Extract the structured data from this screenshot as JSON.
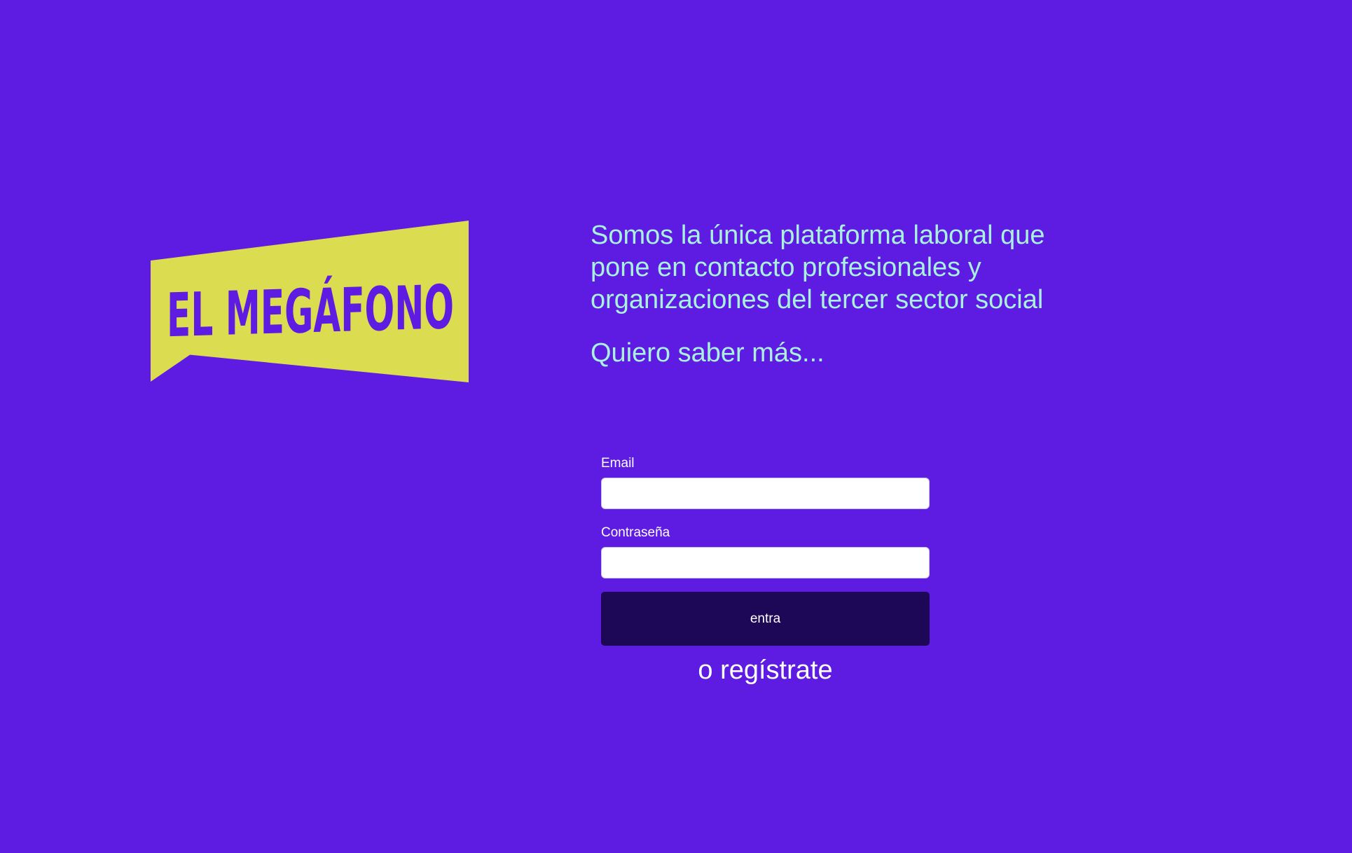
{
  "brand": {
    "logo_text": "EL MEGÁFONO",
    "colors": {
      "background": "#5e1be2",
      "logo_yellow": "#dcdc50",
      "logo_text": "#5e1be2",
      "tagline": "#a9f0dd",
      "button": "#1d0757"
    }
  },
  "hero": {
    "tagline": "Somos la única plataforma laboral que pone en contacto profesionales y organizaciones del tercer sector social",
    "more_link": "Quiero saber más..."
  },
  "login": {
    "email_label": "Email",
    "email_value": "",
    "password_label": "Contraseña",
    "password_value": "",
    "submit_label": "entra",
    "register_link": "o regístrate"
  }
}
